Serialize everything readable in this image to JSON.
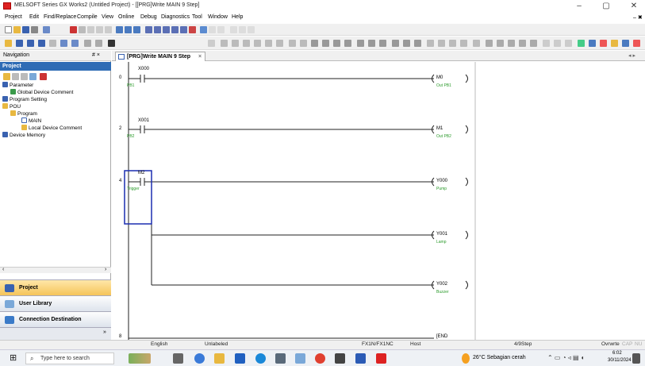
{
  "window": {
    "title": "MELSOFT Series GX Works2 (Untitled Project) - [[PRG]Write MAIN 9 Step]",
    "minimize": "–",
    "maximize": "▢",
    "close": "✕",
    "restore_child": "–  ✖"
  },
  "menu": [
    "Project",
    "Edit",
    "Find/Replace",
    "Compile",
    "View",
    "Online",
    "Debug",
    "Diagnostics",
    "Tool",
    "Window",
    "Help"
  ],
  "navigation": {
    "header": "Navigation",
    "pin": "# ×",
    "project_label": "Project",
    "tree": [
      {
        "label": "Parameter",
        "indent": 0
      },
      {
        "label": "Global Device Comment",
        "indent": 1
      },
      {
        "label": "Program Setting",
        "indent": 0
      },
      {
        "label": "POU",
        "indent": 0
      },
      {
        "label": "Program",
        "indent": 1
      },
      {
        "label": "MAIN",
        "indent": 2
      },
      {
        "label": "Local Device Comment",
        "indent": 2
      },
      {
        "label": "Device Memory",
        "indent": 0
      }
    ],
    "buttons": [
      "Project",
      "User Library",
      "Connection Destination"
    ]
  },
  "editor": {
    "tab_label": "[PRG]Write MAIN 9 Step",
    "tab_nav": "◂ ▸",
    "rungs": [
      {
        "step": "0",
        "contact": "X000",
        "contact_comment": "PB1",
        "coil": "M0",
        "coil_comment": "Out PB1"
      },
      {
        "step": "2",
        "contact": "X001",
        "contact_comment": "PB2",
        "coil": "M1",
        "coil_comment": "Out PB2"
      },
      {
        "step": "4",
        "contact": "M2",
        "contact_comment": "Trigger",
        "coil": "Y000",
        "coil_comment": "Pump"
      }
    ],
    "branch_coils": [
      {
        "coil": "Y001",
        "coil_comment": "Lamp"
      },
      {
        "coil": "Y002",
        "coil_comment": "Buzzer"
      }
    ],
    "end_step": "8",
    "end_label": "[END"
  },
  "status": {
    "language": "English",
    "label": "Unlabeled",
    "cpu": "FX1N/FX1NC",
    "connection": "Host",
    "step": "4/9Step",
    "mode": "Ovrwrte",
    "cap": "CAP",
    "num": "NU"
  },
  "taskbar": {
    "search_placeholder": "Type here to search",
    "weather": "26°C  Sebagian cerah",
    "time": "6:02",
    "date": "30/11/2024"
  }
}
